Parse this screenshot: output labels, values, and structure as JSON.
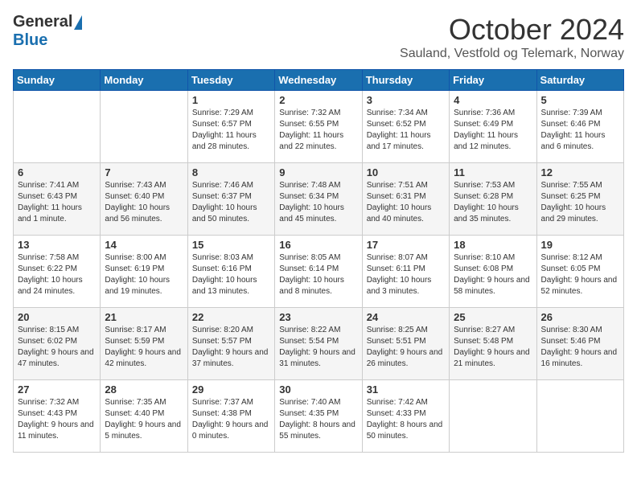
{
  "header": {
    "logo_general": "General",
    "logo_blue": "Blue",
    "month_title": "October 2024",
    "location": "Sauland, Vestfold og Telemark, Norway"
  },
  "weekdays": [
    "Sunday",
    "Monday",
    "Tuesday",
    "Wednesday",
    "Thursday",
    "Friday",
    "Saturday"
  ],
  "weeks": [
    [
      {
        "day": "",
        "sunrise": "",
        "sunset": "",
        "daylight": ""
      },
      {
        "day": "",
        "sunrise": "",
        "sunset": "",
        "daylight": ""
      },
      {
        "day": "1",
        "sunrise": "Sunrise: 7:29 AM",
        "sunset": "Sunset: 6:57 PM",
        "daylight": "Daylight: 11 hours and 28 minutes."
      },
      {
        "day": "2",
        "sunrise": "Sunrise: 7:32 AM",
        "sunset": "Sunset: 6:55 PM",
        "daylight": "Daylight: 11 hours and 22 minutes."
      },
      {
        "day": "3",
        "sunrise": "Sunrise: 7:34 AM",
        "sunset": "Sunset: 6:52 PM",
        "daylight": "Daylight: 11 hours and 17 minutes."
      },
      {
        "day": "4",
        "sunrise": "Sunrise: 7:36 AM",
        "sunset": "Sunset: 6:49 PM",
        "daylight": "Daylight: 11 hours and 12 minutes."
      },
      {
        "day": "5",
        "sunrise": "Sunrise: 7:39 AM",
        "sunset": "Sunset: 6:46 PM",
        "daylight": "Daylight: 11 hours and 6 minutes."
      }
    ],
    [
      {
        "day": "6",
        "sunrise": "Sunrise: 7:41 AM",
        "sunset": "Sunset: 6:43 PM",
        "daylight": "Daylight: 11 hours and 1 minute."
      },
      {
        "day": "7",
        "sunrise": "Sunrise: 7:43 AM",
        "sunset": "Sunset: 6:40 PM",
        "daylight": "Daylight: 10 hours and 56 minutes."
      },
      {
        "day": "8",
        "sunrise": "Sunrise: 7:46 AM",
        "sunset": "Sunset: 6:37 PM",
        "daylight": "Daylight: 10 hours and 50 minutes."
      },
      {
        "day": "9",
        "sunrise": "Sunrise: 7:48 AM",
        "sunset": "Sunset: 6:34 PM",
        "daylight": "Daylight: 10 hours and 45 minutes."
      },
      {
        "day": "10",
        "sunrise": "Sunrise: 7:51 AM",
        "sunset": "Sunset: 6:31 PM",
        "daylight": "Daylight: 10 hours and 40 minutes."
      },
      {
        "day": "11",
        "sunrise": "Sunrise: 7:53 AM",
        "sunset": "Sunset: 6:28 PM",
        "daylight": "Daylight: 10 hours and 35 minutes."
      },
      {
        "day": "12",
        "sunrise": "Sunrise: 7:55 AM",
        "sunset": "Sunset: 6:25 PM",
        "daylight": "Daylight: 10 hours and 29 minutes."
      }
    ],
    [
      {
        "day": "13",
        "sunrise": "Sunrise: 7:58 AM",
        "sunset": "Sunset: 6:22 PM",
        "daylight": "Daylight: 10 hours and 24 minutes."
      },
      {
        "day": "14",
        "sunrise": "Sunrise: 8:00 AM",
        "sunset": "Sunset: 6:19 PM",
        "daylight": "Daylight: 10 hours and 19 minutes."
      },
      {
        "day": "15",
        "sunrise": "Sunrise: 8:03 AM",
        "sunset": "Sunset: 6:16 PM",
        "daylight": "Daylight: 10 hours and 13 minutes."
      },
      {
        "day": "16",
        "sunrise": "Sunrise: 8:05 AM",
        "sunset": "Sunset: 6:14 PM",
        "daylight": "Daylight: 10 hours and 8 minutes."
      },
      {
        "day": "17",
        "sunrise": "Sunrise: 8:07 AM",
        "sunset": "Sunset: 6:11 PM",
        "daylight": "Daylight: 10 hours and 3 minutes."
      },
      {
        "day": "18",
        "sunrise": "Sunrise: 8:10 AM",
        "sunset": "Sunset: 6:08 PM",
        "daylight": "Daylight: 9 hours and 58 minutes."
      },
      {
        "day": "19",
        "sunrise": "Sunrise: 8:12 AM",
        "sunset": "Sunset: 6:05 PM",
        "daylight": "Daylight: 9 hours and 52 minutes."
      }
    ],
    [
      {
        "day": "20",
        "sunrise": "Sunrise: 8:15 AM",
        "sunset": "Sunset: 6:02 PM",
        "daylight": "Daylight: 9 hours and 47 minutes."
      },
      {
        "day": "21",
        "sunrise": "Sunrise: 8:17 AM",
        "sunset": "Sunset: 5:59 PM",
        "daylight": "Daylight: 9 hours and 42 minutes."
      },
      {
        "day": "22",
        "sunrise": "Sunrise: 8:20 AM",
        "sunset": "Sunset: 5:57 PM",
        "daylight": "Daylight: 9 hours and 37 minutes."
      },
      {
        "day": "23",
        "sunrise": "Sunrise: 8:22 AM",
        "sunset": "Sunset: 5:54 PM",
        "daylight": "Daylight: 9 hours and 31 minutes."
      },
      {
        "day": "24",
        "sunrise": "Sunrise: 8:25 AM",
        "sunset": "Sunset: 5:51 PM",
        "daylight": "Daylight: 9 hours and 26 minutes."
      },
      {
        "day": "25",
        "sunrise": "Sunrise: 8:27 AM",
        "sunset": "Sunset: 5:48 PM",
        "daylight": "Daylight: 9 hours and 21 minutes."
      },
      {
        "day": "26",
        "sunrise": "Sunrise: 8:30 AM",
        "sunset": "Sunset: 5:46 PM",
        "daylight": "Daylight: 9 hours and 16 minutes."
      }
    ],
    [
      {
        "day": "27",
        "sunrise": "Sunrise: 7:32 AM",
        "sunset": "Sunset: 4:43 PM",
        "daylight": "Daylight: 9 hours and 11 minutes."
      },
      {
        "day": "28",
        "sunrise": "Sunrise: 7:35 AM",
        "sunset": "Sunset: 4:40 PM",
        "daylight": "Daylight: 9 hours and 5 minutes."
      },
      {
        "day": "29",
        "sunrise": "Sunrise: 7:37 AM",
        "sunset": "Sunset: 4:38 PM",
        "daylight": "Daylight: 9 hours and 0 minutes."
      },
      {
        "day": "30",
        "sunrise": "Sunrise: 7:40 AM",
        "sunset": "Sunset: 4:35 PM",
        "daylight": "Daylight: 8 hours and 55 minutes."
      },
      {
        "day": "31",
        "sunrise": "Sunrise: 7:42 AM",
        "sunset": "Sunset: 4:33 PM",
        "daylight": "Daylight: 8 hours and 50 minutes."
      },
      {
        "day": "",
        "sunrise": "",
        "sunset": "",
        "daylight": ""
      },
      {
        "day": "",
        "sunrise": "",
        "sunset": "",
        "daylight": ""
      }
    ]
  ]
}
